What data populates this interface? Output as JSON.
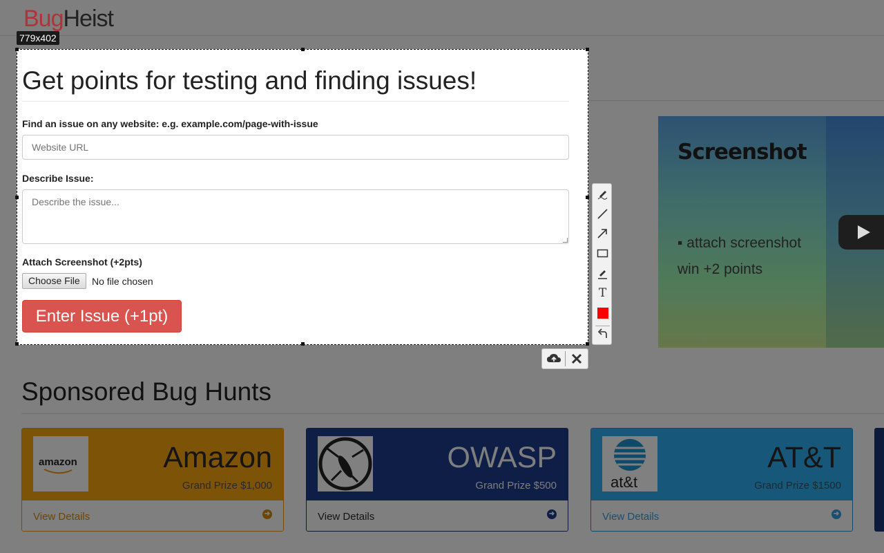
{
  "header": {
    "logo_part1": "Bug",
    "logo_part2": "Heist"
  },
  "selection": {
    "dimensions": "779x402",
    "heading": "Get points for testing and finding issues!",
    "url_label": "Find an issue on any website: e.g. example.com/page-with-issue",
    "url_placeholder": "Website URL",
    "describe_label": "Describe Issue:",
    "describe_placeholder": "Describe the issue...",
    "attach_label": "Attach Screenshot (+2pts)",
    "choose_file": "Choose File",
    "no_file": "No file chosen",
    "submit": "Enter Issue (+1pt)"
  },
  "toolbar": {
    "tools": [
      "pencil-icon",
      "line-icon",
      "arrow-icon",
      "rectangle-icon",
      "highlighter-icon",
      "text-icon",
      "color-swatch",
      "undo-icon"
    ],
    "text_tool": "T",
    "current_color": "#ff0000",
    "actions": [
      "upload-cloud-icon",
      "close-icon"
    ]
  },
  "video": {
    "title": "Screenshot",
    "line1": "▪ attach screenshot",
    "line2": "win +2 points"
  },
  "sponsored": {
    "title": "Sponsored Bug Hunts",
    "cards": [
      {
        "name": "Amazon",
        "prize": "Grand Prize $1,000",
        "details": "View Details",
        "logo_text": "amazon"
      },
      {
        "name": "OWASP",
        "prize": "Grand Prize $500",
        "details": "View Details"
      },
      {
        "name": "AT&T",
        "prize": "Grand Prize $1500",
        "details": "View Details",
        "logo_text": "at&t"
      }
    ]
  }
}
